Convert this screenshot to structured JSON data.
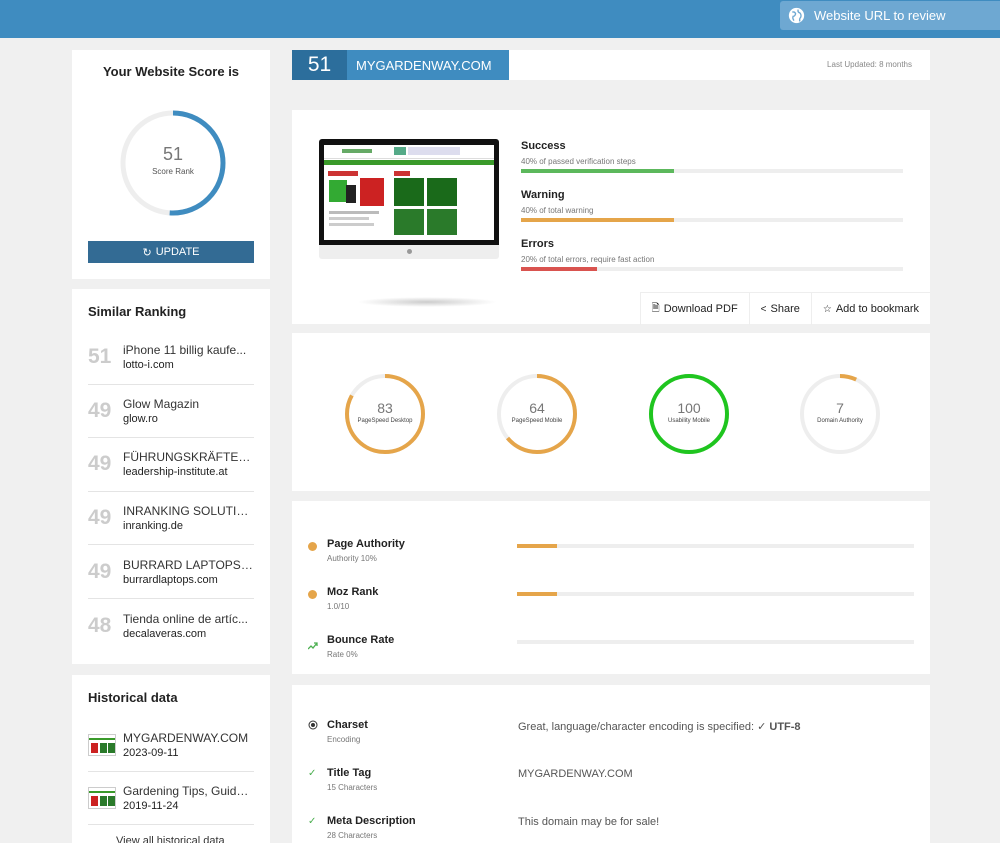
{
  "topbar": {
    "url_placeholder": "Website URL to review",
    "icon": "globe-icon"
  },
  "score": {
    "title": "Your Website Score is",
    "value": 51,
    "label": "Score Rank",
    "max": 100,
    "update_label": "UPDATE",
    "color": "#3f8cc0"
  },
  "similar": {
    "title": "Similar Ranking",
    "items": [
      {
        "score": "51",
        "name": "iPhone 11 billig kaufe...",
        "domain": "lotto-i.com"
      },
      {
        "score": "49",
        "name": "Glow Magazin",
        "domain": "glow.ro"
      },
      {
        "score": "49",
        "name": "FÜHRUNGSKRÄFTE C...",
        "domain": "leadership-institute.at"
      },
      {
        "score": "49",
        "name": "INRANKING SOLUTIO...",
        "domain": "inranking.de"
      },
      {
        "score": "49",
        "name": "BURRARD LAPTOPS: ...",
        "domain": "burrardlaptops.com"
      },
      {
        "score": "48",
        "name": "Tienda online de artíc...",
        "domain": "decalaveras.com"
      }
    ]
  },
  "historical": {
    "title": "Historical data",
    "items": [
      {
        "title": "MYGARDENWAY.COM",
        "date": "2023-09-11"
      },
      {
        "title": "Gardening Tips, Guide...",
        "date": "2019-11-24"
      }
    ],
    "more_label": "View all historical data"
  },
  "site": {
    "score": "51",
    "domain": "MYGARDENWAY.COM",
    "last_updated": "Last Updated: 8 months"
  },
  "checks": [
    {
      "title": "Success",
      "desc": "40% of passed verification steps",
      "value": 40,
      "color": "#5cb85c"
    },
    {
      "title": "Warning",
      "desc": "40% of total warning",
      "value": 40,
      "color": "#e5a54a"
    },
    {
      "title": "Errors",
      "desc": "20% of total errors, require fast action",
      "value": 20,
      "color": "#d9534f"
    }
  ],
  "actions": {
    "download": "Download PDF",
    "share": "Share",
    "bookmark": "Add to bookmark"
  },
  "gauges": [
    {
      "value": 83,
      "label": "PageSpeed Desktop",
      "color": "#e5a54a"
    },
    {
      "value": 64,
      "label": "PageSpeed Mobile",
      "color": "#e5a54a"
    },
    {
      "value": 100,
      "label": "Usability Mobile",
      "color": "#1fc51f"
    },
    {
      "value": 7,
      "label": "Domain Authority",
      "color": "#e5a54a"
    }
  ],
  "metrics": [
    {
      "title": "Page Authority",
      "sub": "Authority 10%",
      "value": 10,
      "icon": "orange-dot-icon"
    },
    {
      "title": "Moz Rank",
      "sub": "1.0/10",
      "value": 10,
      "icon": "orange-dot-icon"
    },
    {
      "title": "Bounce Rate",
      "sub": "Rate 0%",
      "value": 0,
      "icon": "trend-up-icon"
    }
  ],
  "seo": [
    {
      "title": "Charset",
      "sub": "Encoding",
      "value": "Great, language/character encoding is specified: ",
      "extra": "UTF-8",
      "icon": "radio-icon"
    },
    {
      "title": "Title Tag",
      "sub": "15 Characters",
      "value": "MYGARDENWAY.COM",
      "extra": "",
      "icon": "check-icon"
    },
    {
      "title": "Meta Description",
      "sub": "28 Characters",
      "value": "This domain may be for sale!",
      "extra": "",
      "icon": "check-icon"
    }
  ]
}
